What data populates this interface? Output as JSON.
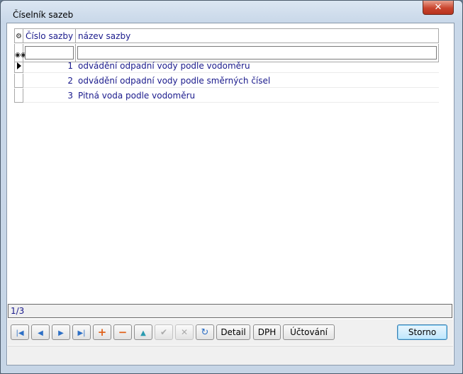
{
  "window": {
    "title": "Číselník sazeb",
    "close_glyph": "✕"
  },
  "grid": {
    "columns": [
      "Číslo sazby",
      "název sazby"
    ],
    "filter_icon": "binoculars-icon",
    "header_icon": "column-settings-icon",
    "rows": [
      {
        "num": "1",
        "name": "odvádění odpadní vody podle vodoměru"
      },
      {
        "num": "2",
        "name": "odvádění odpadní vody podle směrných čísel"
      },
      {
        "num": "3",
        "name": "Pitná voda podle vodoměru"
      }
    ]
  },
  "status": {
    "record": "1/3"
  },
  "toolbar": {
    "first_glyph": "|◀",
    "prev_glyph": "◀",
    "next_glyph": "▶",
    "last_glyph": "▶|",
    "add_glyph": "+",
    "delete_glyph": "−",
    "up_glyph": "▲",
    "confirm_glyph": "✔",
    "cancel_glyph": "✕",
    "refresh_glyph": "↻",
    "detail_label": "Detail",
    "vat_label": "DPH",
    "accounting_label": "Účtování",
    "storno_label": "Storno"
  }
}
